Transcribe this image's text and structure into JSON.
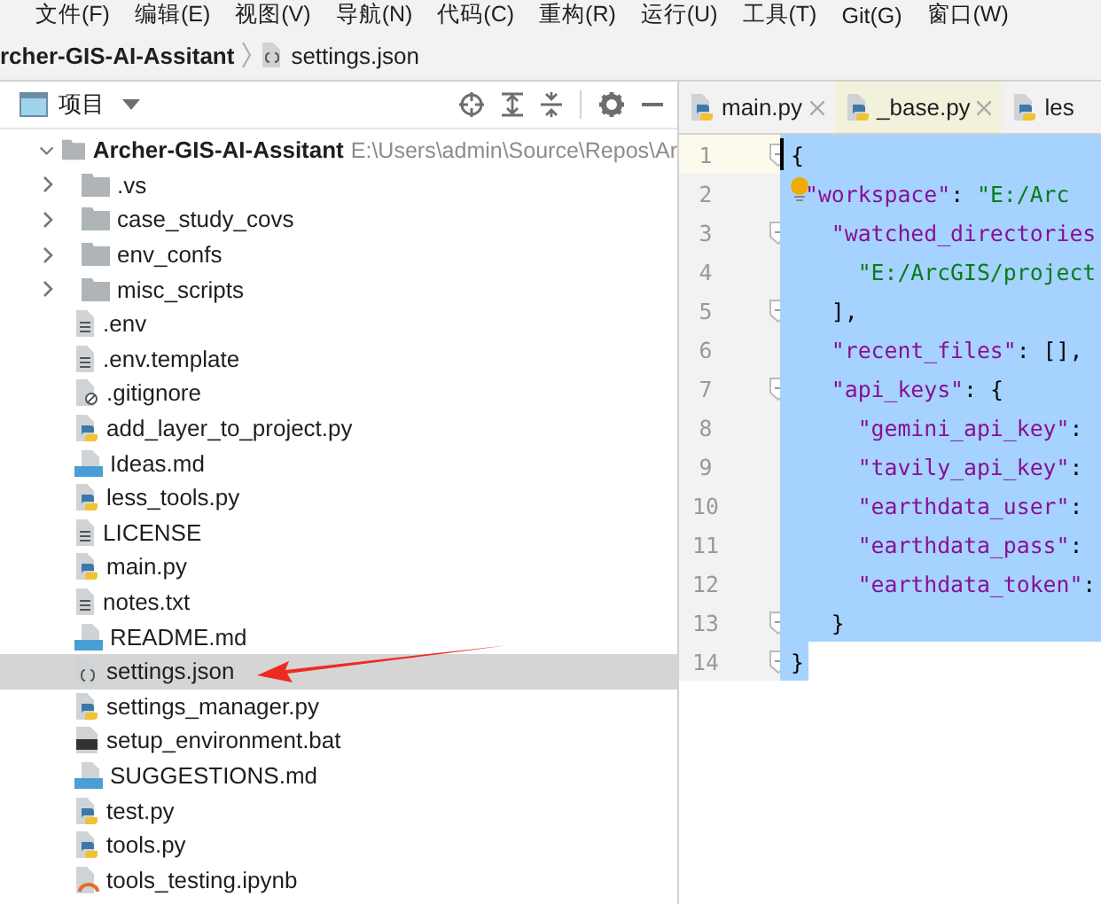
{
  "menu": [
    "文件(F)",
    "编辑(E)",
    "视图(V)",
    "导航(N)",
    "代码(C)",
    "重构(R)",
    "运行(U)",
    "工具(T)",
    "Git(G)",
    "窗口(W)"
  ],
  "breadcrumb": {
    "project": "rcher-GIS-AI-Assitant",
    "file": "settings.json"
  },
  "project_panel": {
    "title": "项目"
  },
  "tree": [
    {
      "name": "Archer-GIS-AI-Assitant",
      "path": "E:\\Users\\admin\\Source\\Repos\\Ar",
      "kind": "folder",
      "expanded": true,
      "selected": false,
      "children": [
        {
          "name": ".vs",
          "kind": "folder",
          "expanded": false,
          "selected": false
        },
        {
          "name": "case_study_covs",
          "kind": "folder",
          "expanded": false,
          "selected": false
        },
        {
          "name": "env_confs",
          "kind": "folder",
          "expanded": false,
          "selected": false
        },
        {
          "name": "misc_scripts",
          "kind": "folder",
          "expanded": false,
          "selected": false
        },
        {
          "name": ".env",
          "kind": "text",
          "selected": false
        },
        {
          "name": ".env.template",
          "kind": "text",
          "selected": false
        },
        {
          "name": ".gitignore",
          "kind": "ignore",
          "selected": false
        },
        {
          "name": "add_layer_to_project.py",
          "kind": "python",
          "selected": false
        },
        {
          "name": "Ideas.md",
          "kind": "markdown",
          "selected": false
        },
        {
          "name": "less_tools.py",
          "kind": "python",
          "selected": false
        },
        {
          "name": "LICENSE",
          "kind": "text",
          "selected": false
        },
        {
          "name": "main.py",
          "kind": "python",
          "selected": false
        },
        {
          "name": "notes.txt",
          "kind": "text",
          "selected": false
        },
        {
          "name": "README.md",
          "kind": "markdown",
          "selected": false
        },
        {
          "name": "settings.json",
          "kind": "json",
          "selected": true
        },
        {
          "name": "settings_manager.py",
          "kind": "python",
          "selected": false
        },
        {
          "name": "setup_environment.bat",
          "kind": "batch",
          "selected": false
        },
        {
          "name": "SUGGESTIONS.md",
          "kind": "markdown",
          "selected": false
        },
        {
          "name": "test.py",
          "kind": "python",
          "selected": false
        },
        {
          "name": "tools.py",
          "kind": "python",
          "selected": false
        },
        {
          "name": "tools_testing.ipynb",
          "kind": "notebook",
          "selected": false
        }
      ]
    }
  ],
  "tabs": [
    {
      "label": "main.py",
      "selected": false,
      "closable": true
    },
    {
      "label": "_base.py",
      "selected": true,
      "closable": true
    },
    {
      "label": "les",
      "selected": false,
      "closable": false
    }
  ],
  "editor": {
    "lines": [
      {
        "number": "1",
        "fold": true,
        "current": true,
        "hint": false,
        "tokens": [
          {
            "kind": "punct",
            "text": "{"
          }
        ]
      },
      {
        "number": "2",
        "fold": false,
        "current": false,
        "hint": true,
        "tokens": [
          {
            "kind": "key",
            "text": "\"workspace\""
          },
          {
            "kind": "punct",
            "text": ": "
          },
          {
            "kind": "string",
            "text": "\"E:/Arc"
          }
        ]
      },
      {
        "number": "3",
        "fold": true,
        "current": false,
        "hint": false,
        "tokens": [
          {
            "kind": "key",
            "text": "  \"watched_directories"
          }
        ]
      },
      {
        "number": "4",
        "fold": false,
        "current": false,
        "hint": false,
        "tokens": [
          {
            "kind": "string",
            "text": "    \"E:/ArcGIS/project"
          }
        ]
      },
      {
        "number": "5",
        "fold": true,
        "current": false,
        "hint": false,
        "tokens": [
          {
            "kind": "punct",
            "text": "  ],"
          }
        ]
      },
      {
        "number": "6",
        "fold": false,
        "current": false,
        "hint": false,
        "tokens": [
          {
            "kind": "key",
            "text": "  \"recent_files\""
          },
          {
            "kind": "punct",
            "text": ": [],"
          }
        ]
      },
      {
        "number": "7",
        "fold": true,
        "current": false,
        "hint": false,
        "tokens": [
          {
            "kind": "key",
            "text": "  \"api_keys\""
          },
          {
            "kind": "punct",
            "text": ": {"
          }
        ]
      },
      {
        "number": "8",
        "fold": false,
        "current": false,
        "hint": false,
        "tokens": [
          {
            "kind": "key",
            "text": "    \"gemini_api_key\""
          },
          {
            "kind": "punct",
            "text": ":"
          }
        ]
      },
      {
        "number": "9",
        "fold": false,
        "current": false,
        "hint": false,
        "tokens": [
          {
            "kind": "key",
            "text": "    \"tavily_api_key\""
          },
          {
            "kind": "punct",
            "text": ":"
          }
        ]
      },
      {
        "number": "10",
        "fold": false,
        "current": false,
        "hint": false,
        "tokens": [
          {
            "kind": "key",
            "text": "    \"earthdata_user\""
          },
          {
            "kind": "punct",
            "text": ":"
          }
        ]
      },
      {
        "number": "11",
        "fold": false,
        "current": false,
        "hint": false,
        "tokens": [
          {
            "kind": "key",
            "text": "    \"earthdata_pass\""
          },
          {
            "kind": "punct",
            "text": ":"
          }
        ]
      },
      {
        "number": "12",
        "fold": false,
        "current": false,
        "hint": false,
        "tokens": [
          {
            "kind": "key",
            "text": "    \"earthdata_token\""
          },
          {
            "kind": "punct",
            "text": ":"
          }
        ]
      },
      {
        "number": "13",
        "fold": true,
        "current": false,
        "hint": false,
        "tokens": [
          {
            "kind": "punct",
            "text": "  }"
          }
        ]
      },
      {
        "number": "14",
        "fold": true,
        "current": false,
        "hint": false,
        "tokens": [
          {
            "kind": "punct",
            "text": "}"
          }
        ]
      }
    ]
  }
}
